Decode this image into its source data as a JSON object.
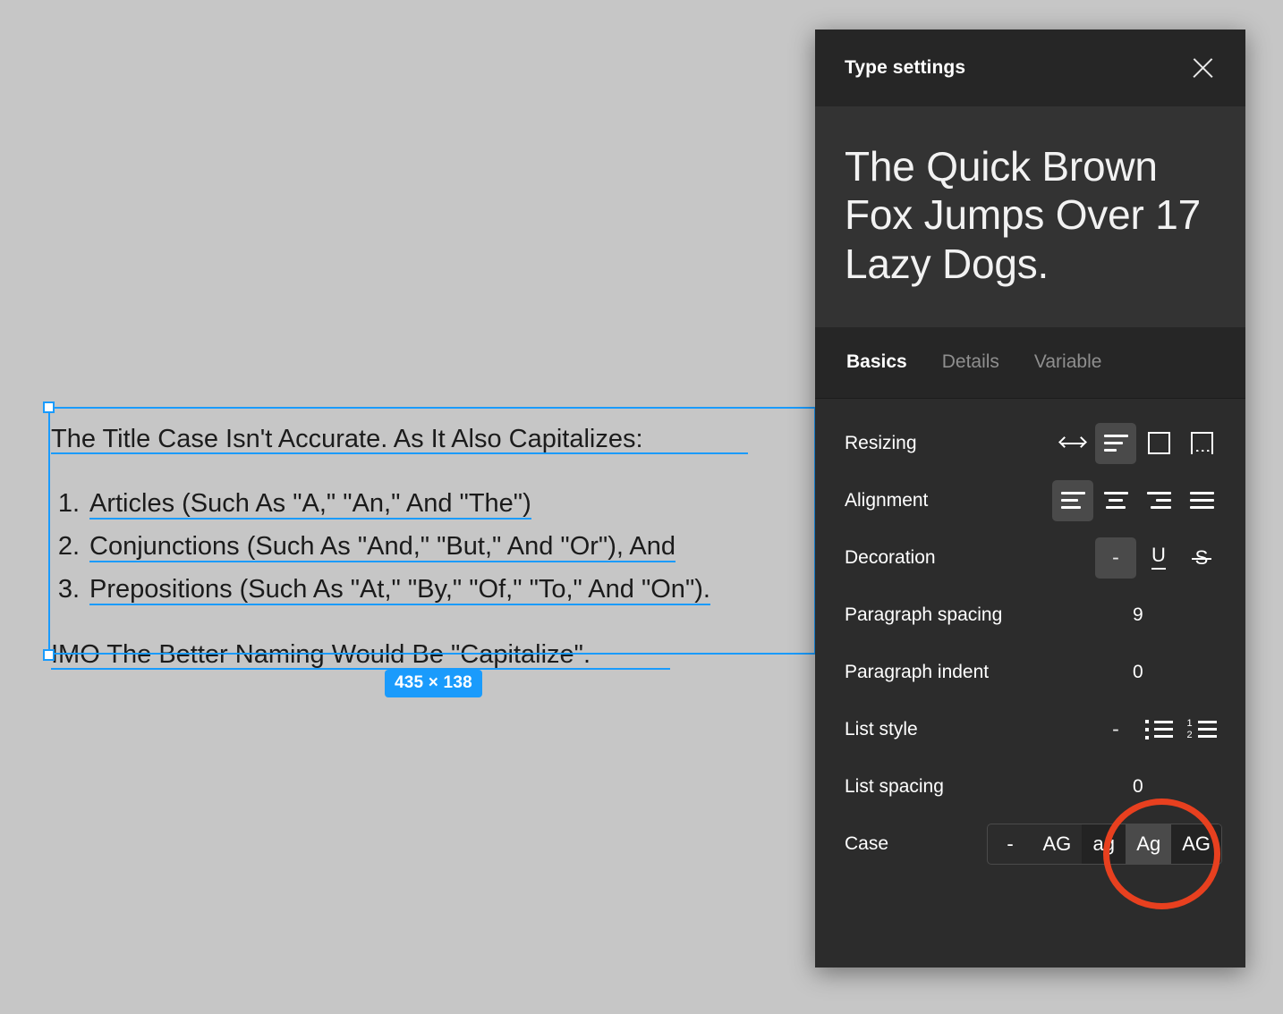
{
  "canvas": {
    "background_color": "#c6c6c6",
    "selection_color": "#1a9bfc",
    "size_badge": "435 × 138",
    "text_layer": {
      "heading": "The Title Case Isn't Accurate. As It Also Capitalizes:",
      "list": [
        {
          "marker": "1.",
          "text": "Articles (Such As \"A,\" \"An,\" And \"The\")"
        },
        {
          "marker": "2.",
          "text": "Conjunctions (Such As \"And,\" \"But,\" And \"Or\"), And"
        },
        {
          "marker": "3.",
          "text": "Prepositions (Such As \"At,\" \"By,\" \"Of,\" \"To,\" And \"On\")."
        }
      ],
      "closing": "IMO The Better Naming Would Be \"Capitalize\"."
    }
  },
  "panel": {
    "title": "Type settings",
    "close_icon": "close-icon",
    "preview_text": "The Quick Brown Fox Jumps Over 17 Lazy Dogs.",
    "tabs": [
      {
        "label": "Basics",
        "active": true
      },
      {
        "label": "Details",
        "active": false
      },
      {
        "label": "Variable",
        "active": false
      }
    ],
    "rows": {
      "resizing": {
        "label": "Resizing",
        "options": [
          {
            "icon": "auto-width-icon",
            "selected": false
          },
          {
            "icon": "auto-height-icon",
            "selected": true
          },
          {
            "icon": "fixed-size-icon",
            "selected": false
          },
          {
            "icon": "truncate-text-icon",
            "selected": false
          }
        ]
      },
      "alignment": {
        "label": "Alignment",
        "options": [
          {
            "icon": "align-left-icon",
            "selected": true
          },
          {
            "icon": "align-center-icon",
            "selected": false
          },
          {
            "icon": "align-right-icon",
            "selected": false
          },
          {
            "icon": "align-justify-icon",
            "selected": false
          }
        ]
      },
      "decoration": {
        "label": "Decoration",
        "options": [
          {
            "label": "-",
            "icon": "no-decoration-icon",
            "selected": true
          },
          {
            "label": "U",
            "icon": "underline-icon",
            "selected": false
          },
          {
            "label": "S",
            "icon": "strikethrough-icon",
            "selected": false
          }
        ]
      },
      "paragraph_spacing": {
        "label": "Paragraph spacing",
        "value": "9"
      },
      "paragraph_indent": {
        "label": "Paragraph indent",
        "value": "0"
      },
      "list_style": {
        "label": "List style",
        "options": [
          {
            "label": "-",
            "icon": "no-list-icon",
            "selected": false
          },
          {
            "icon": "bulleted-list-icon",
            "selected": false
          },
          {
            "icon": "numbered-list-icon",
            "selected": false
          }
        ]
      },
      "list_spacing": {
        "label": "List spacing",
        "value": "0"
      },
      "case": {
        "label": "Case",
        "options": [
          {
            "label": "-",
            "name": "case-none",
            "state": "normal"
          },
          {
            "label": "AG",
            "name": "case-uppercase",
            "state": "normal"
          },
          {
            "label": "ag",
            "name": "case-lowercase",
            "state": "dim"
          },
          {
            "label": "Ag",
            "name": "case-title",
            "state": "selected"
          },
          {
            "label": "AG",
            "name": "case-small-caps",
            "state": "dim"
          }
        ]
      }
    }
  },
  "annotation": {
    "shape": "circle",
    "color": "#e8401f",
    "target": "case-control"
  }
}
